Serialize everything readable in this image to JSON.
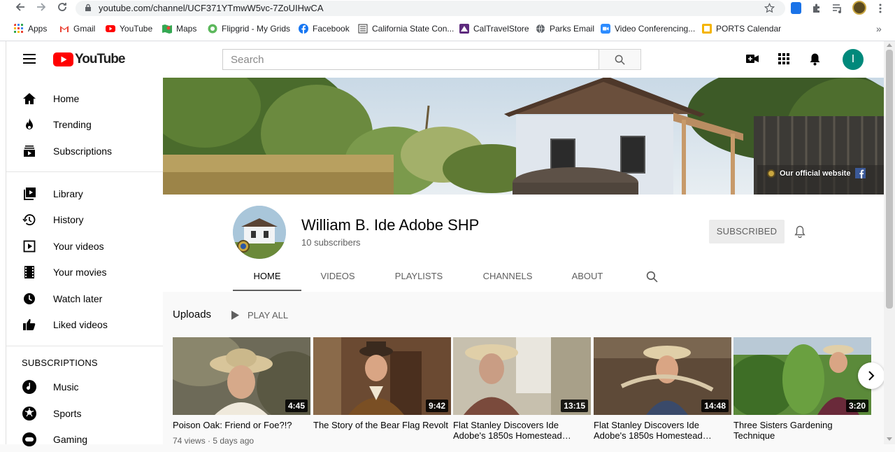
{
  "browser": {
    "url": "youtube.com/channel/UCF371YTmwW5vc-7ZoUIHwCA",
    "bookmarks": [
      {
        "label": "Apps",
        "icon": "apps-grid-icon"
      },
      {
        "label": "Gmail",
        "icon": "gmail-icon"
      },
      {
        "label": "YouTube",
        "icon": "youtube-icon"
      },
      {
        "label": "Maps",
        "icon": "maps-icon"
      },
      {
        "label": "Flipgrid - My Grids",
        "icon": "flipgrid-icon"
      },
      {
        "label": "Facebook",
        "icon": "facebook-icon"
      },
      {
        "label": "California State Con...",
        "icon": "building-icon"
      },
      {
        "label": "CalTravelStore",
        "icon": "caltravel-icon"
      },
      {
        "label": "Parks Email",
        "icon": "globe-icon"
      },
      {
        "label": "Video Conferencing...",
        "icon": "video-conf-icon"
      },
      {
        "label": "PORTS Calendar",
        "icon": "ports-icon"
      }
    ],
    "more_label": "»"
  },
  "header": {
    "logo_text": "YouTube",
    "search_placeholder": "Search",
    "avatar_letter": "I"
  },
  "sidebar": {
    "items": [
      {
        "label": "Home",
        "icon": "home-icon"
      },
      {
        "label": "Trending",
        "icon": "trending-flame-icon"
      },
      {
        "label": "Subscriptions",
        "icon": "subscriptions-icon"
      },
      {
        "label": "Library",
        "icon": "library-icon"
      },
      {
        "label": "History",
        "icon": "history-icon"
      },
      {
        "label": "Your videos",
        "icon": "your-videos-icon"
      },
      {
        "label": "Your movies",
        "icon": "movies-icon"
      },
      {
        "label": "Watch later",
        "icon": "clock-icon"
      },
      {
        "label": "Liked videos",
        "icon": "thumbs-up-icon"
      }
    ],
    "subscriptions_heading": "SUBSCRIPTIONS",
    "subscriptions": [
      {
        "label": "Music",
        "icon": "music-icon"
      },
      {
        "label": "Sports",
        "icon": "sports-icon"
      },
      {
        "label": "Gaming",
        "icon": "gaming-icon"
      }
    ]
  },
  "banner": {
    "link_label": "Our official website"
  },
  "channel": {
    "name": "William B. Ide Adobe SHP",
    "subscribers": "10 subscribers",
    "subscribe_label": "SUBSCRIBED",
    "tabs": [
      "HOME",
      "VIDEOS",
      "PLAYLISTS",
      "CHANNELS",
      "ABOUT"
    ],
    "active_tab": "HOME"
  },
  "uploads": {
    "heading": "Uploads",
    "play_all": "PLAY ALL",
    "videos": [
      {
        "title": "Poison Oak: Friend or Foe?!?",
        "duration": "4:45",
        "meta": "74 views · 5 days ago"
      },
      {
        "title": "The Story of the Bear Flag Revolt",
        "duration": "9:42"
      },
      {
        "title": "Flat Stanley Discovers Ide Adobe's 1850s Homestead…",
        "duration": "13:15"
      },
      {
        "title": "Flat Stanley Discovers Ide Adobe's 1850s Homestead…",
        "duration": "14:48"
      },
      {
        "title": "Three Sisters Gardening Technique",
        "duration": "3:20"
      }
    ]
  },
  "colors": {
    "youtube_red": "#ff0000",
    "avatar_bg": "#00897b",
    "subscribed_bg": "#ececec"
  }
}
